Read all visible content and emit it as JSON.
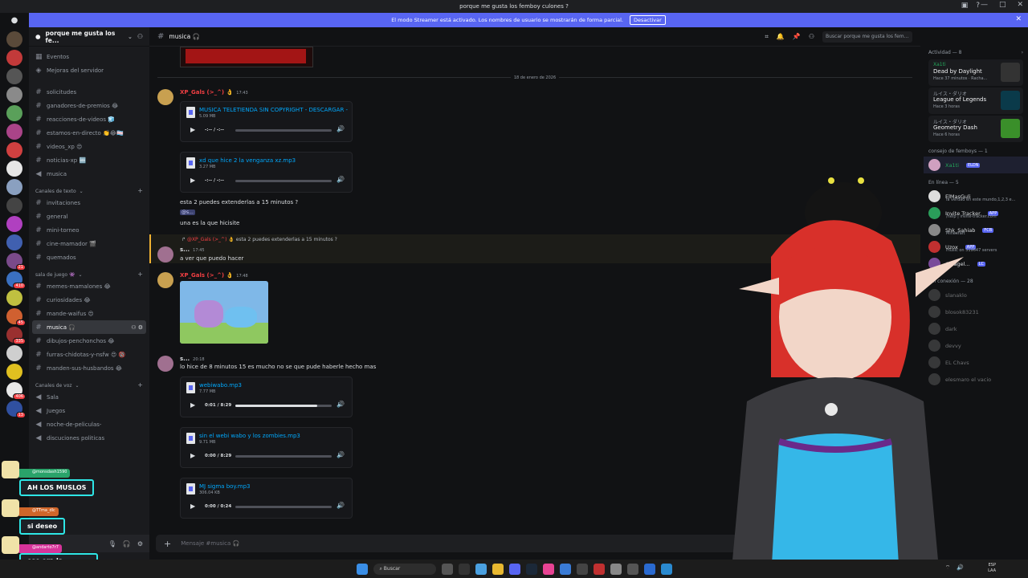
{
  "titlebar": {
    "title": "porque me gusta los femboy culones ?",
    "window_buttons": [
      "—",
      "□",
      "✕"
    ]
  },
  "streamer_banner": {
    "text": "El modo Streamer está activado. Los nombres de usuario se mostrarán de forma parcial.",
    "button": "Desactivar"
  },
  "server": {
    "name": "porque me gusta los fe..."
  },
  "sidebar_top": [
    {
      "label": "Eventos"
    },
    {
      "label": "Mejoras del servidor"
    }
  ],
  "channels_ungrouped": [
    {
      "label": "solicitudes"
    },
    {
      "label": "ganadores-de-premios 😂"
    },
    {
      "label": "reacciones-de-videos 🧊"
    },
    {
      "label": "estamos-en-directo 👏😂🏳️‍⚧️"
    },
    {
      "label": "videos_xp 😍"
    },
    {
      "label": "noticias-xp 🆕"
    },
    {
      "label": "musica"
    }
  ],
  "categories": {
    "texto": {
      "label": "Canales de texto",
      "items": [
        {
          "label": "invitaciones"
        },
        {
          "label": "general"
        },
        {
          "label": "mini-torneo"
        },
        {
          "label": "cine-mamador 🎬"
        },
        {
          "label": "quemados"
        }
      ]
    },
    "juego": {
      "label": "sala de juego 👾",
      "items": [
        {
          "label": "memes-mamalones 😂"
        },
        {
          "label": "curiosidades 😂"
        },
        {
          "label": "mande-waifus 😍"
        },
        {
          "label": "musica 🎧"
        },
        {
          "label": "dibujos-penchonchos 😂"
        },
        {
          "label": "furras-chidotas-y-nsfw 😍 🔞"
        },
        {
          "label": "manden-sus-husbandos 😂"
        }
      ]
    },
    "voz": {
      "label": "Canales de voz",
      "items": [
        {
          "label": "Sala"
        },
        {
          "label": "Juegos"
        },
        {
          "label": "noche-de-peliculas-"
        },
        {
          "label": "discuciones politicas"
        }
      ]
    }
  },
  "guild_badges": [
    "21",
    "410",
    "45",
    "335",
    "406",
    "13"
  ],
  "overlay_chat": [
    {
      "user": "@monsdash1590",
      "text": "AH LOS MUSLOS"
    },
    {
      "user": "@TTma_dlc",
      "text": "si deseo"
    },
    {
      "user": "@andarto7r7",
      "text": "ese era la intencion"
    }
  ],
  "channel_header": {
    "name": "musica 🎧",
    "search_placeholder": "Buscar porque me gusta los fem..."
  },
  "chat": {
    "date_separator": "18 de enero de 2026",
    "msg1": {
      "user": "XP_Gals (>_^) 👌",
      "time": "17:43"
    },
    "audio1": {
      "name": "MUSICA TELETIENDA SIN COPYRIGHT - DESCARGAR -",
      "size": "5.09 MB",
      "time": "-:-- / -:--",
      "progress": 0
    },
    "audio2": {
      "name": "xd que hice 2 la venganza xz.mp3",
      "size": "3.27 MB",
      "time": "-:-- / -:--",
      "progress": 0
    },
    "text1": "esta 2 puedes extenderlas a 15 minutos ?",
    "mention": "@s...",
    "text2": "una es la que hicisite",
    "reply_preview": {
      "user": "@XP_Gals (>_^) 👌",
      "text": "esta 2 puedes extenderlas a 15 minutos ?"
    },
    "msg2": {
      "user": "s...",
      "time": "17:45",
      "text": "a ver que puedo hacer"
    },
    "msg3": {
      "user": "XP_Gals (>_^) 👌",
      "time": "17:48"
    },
    "msg4": {
      "user": "s...",
      "time": "20:18",
      "text": "lo hice de 8 minutos 15 es mucho no se que pude haberle hecho mas"
    },
    "audio3": {
      "name": "webiwabo.mp3",
      "size": "7.77 MB",
      "time": "0:01 / 8:29",
      "progress": 0.85
    },
    "audio4": {
      "name": "sin el webi wabo y los zombies.mp3",
      "size": "9.71 MB",
      "time": "0:00 / 8:29",
      "progress": 0
    },
    "audio5": {
      "name": "MJ sigma boy.mp3",
      "size": "306.04 KB",
      "time": "0:00 / 0:24",
      "progress": 0
    },
    "input_placeholder": "Mensaje #musica 🎧"
  },
  "members": {
    "activity_header": "Actividad — 8",
    "activities": [
      {
        "user": "Xa1ti",
        "game": "Dead by Daylight",
        "time": "Hace 37 minutos · Racha...",
        "color": "#333"
      },
      {
        "user": "ルイス・ダリオ",
        "game": "League of Legends",
        "time": "Hace 3 horas",
        "color": "#0a3a4a"
      },
      {
        "user": "ルイス・ダリオ",
        "game": "Geometry Dash",
        "time": "Hace 6 horas",
        "color": "#3a8f2a"
      }
    ],
    "council_header": "consejo de femboys — 1",
    "council": [
      {
        "name": "Xa1ti",
        "tag": "ELDN"
      }
    ],
    "online_header": "En línea — 5",
    "online": [
      {
        "name": "ElMasGuli",
        "status": "la verdad en este mundo,1,2,3 e..."
      },
      {
        "name": "Invite Tracker",
        "tag": "APP",
        "status": "/help | invite-tracker.com"
      },
      {
        "name": "Shk_Sahiab",
        "tag": "FCB",
        "status": "Minecraft"
      },
      {
        "name": "Uzox",
        "tag": "APP",
        "status": "music on 519647 servers"
      },
      {
        "name": "Arcagel...",
        "tag": "LC",
        "status": ""
      }
    ],
    "offline_header": "Sin conexión — 28",
    "offline": [
      {
        "name": "slanaklo"
      },
      {
        "name": "blosok83231"
      },
      {
        "name": "dark"
      },
      {
        "name": "devvy"
      },
      {
        "name": "EL Chavs"
      },
      {
        "name": "elesmaro el vacio"
      }
    ]
  },
  "taskbar": {
    "search": "Buscar",
    "lang": "ESP\nLAA"
  }
}
